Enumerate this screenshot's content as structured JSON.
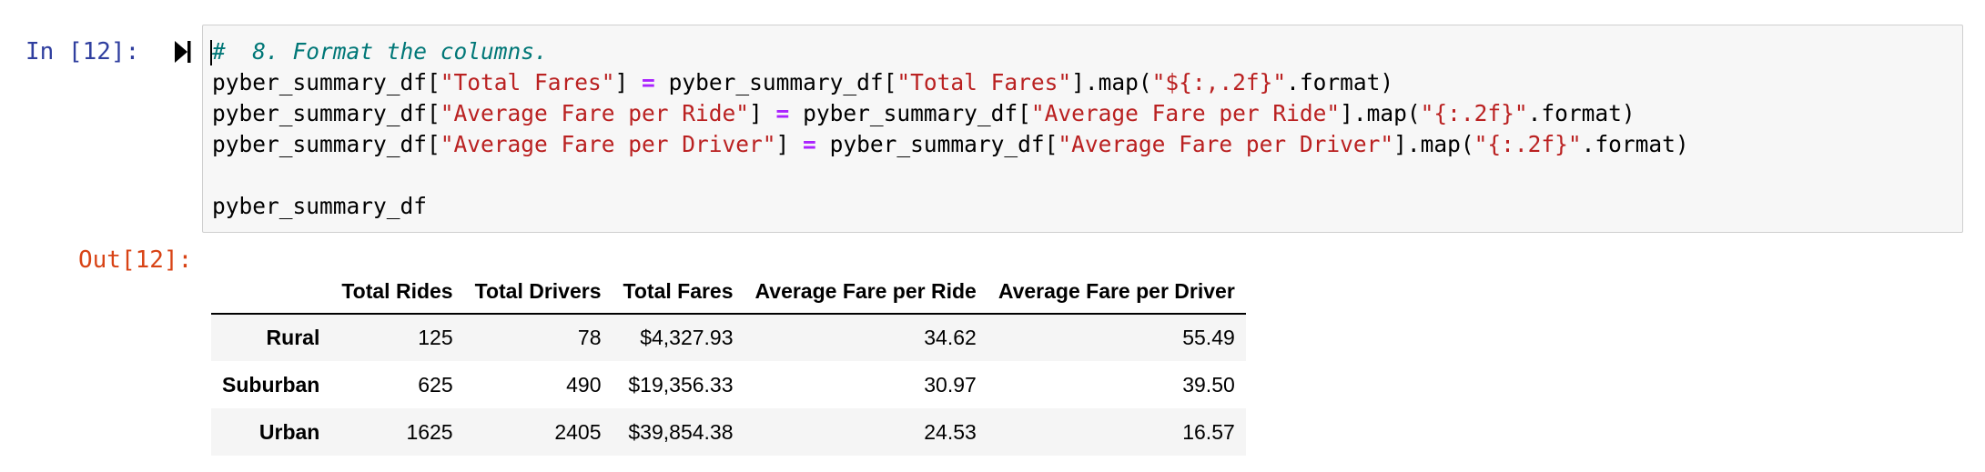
{
  "input_cell": {
    "prompt": "In [12]:",
    "code": {
      "line1": {
        "comment": "#  8. Format the columns."
      },
      "line2": {
        "a": "pyber_summary_df[",
        "s1": "\"Total Fares\"",
        "b": "] ",
        "eq": "=",
        "c": " pyber_summary_df[",
        "s2": "\"Total Fares\"",
        "d": "].map(",
        "s3": "\"${:,.2f}\"",
        "e": ".format)"
      },
      "line3": {
        "a": "pyber_summary_df[",
        "s1": "\"Average Fare per Ride\"",
        "b": "] ",
        "eq": "=",
        "c": " pyber_summary_df[",
        "s2": "\"Average Fare per Ride\"",
        "d": "].map(",
        "s3": "\"{:.2f}\"",
        "e": ".format)"
      },
      "line4": {
        "a": "pyber_summary_df[",
        "s1": "\"Average Fare per Driver\"",
        "b": "] ",
        "eq": "=",
        "c": " pyber_summary_df[",
        "s2": "\"Average Fare per Driver\"",
        "d": "].map(",
        "s3": "\"{:.2f}\"",
        "e": ".format)"
      },
      "line6": "pyber_summary_df"
    }
  },
  "output_cell": {
    "prompt": "Out[12]:",
    "table": {
      "columns": [
        "Total Rides",
        "Total Drivers",
        "Total Fares",
        "Average Fare per Ride",
        "Average Fare per Driver"
      ],
      "rows": [
        {
          "index": "Rural",
          "values": [
            "125",
            "78",
            "$4,327.93",
            "34.62",
            "55.49"
          ]
        },
        {
          "index": "Suburban",
          "values": [
            "625",
            "490",
            "$19,356.33",
            "30.97",
            "39.50"
          ]
        },
        {
          "index": "Urban",
          "values": [
            "1625",
            "2405",
            "$39,854.38",
            "24.53",
            "16.57"
          ]
        }
      ]
    }
  }
}
